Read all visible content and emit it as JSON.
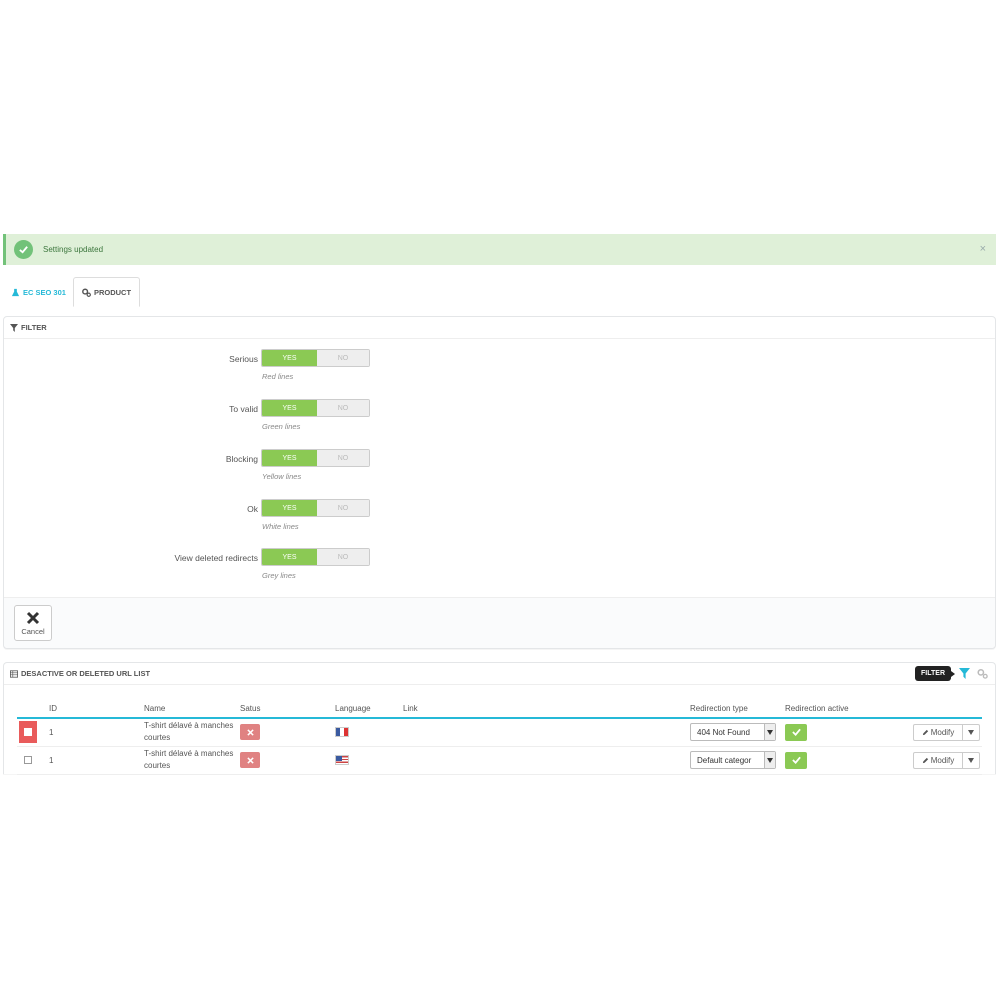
{
  "alert": {
    "message": "Settings updated",
    "close": "×"
  },
  "tabs": [
    {
      "label": "EC SEO 301",
      "icon": "flask-icon",
      "active": false
    },
    {
      "label": "PRODUCT",
      "icon": "gears-icon",
      "active": true
    }
  ],
  "filter_panel": {
    "title": "FILTER",
    "rows": [
      {
        "label": "Serious",
        "yes": "YES",
        "no": "NO",
        "value": "YES",
        "help": "Red lines"
      },
      {
        "label": "To valid",
        "yes": "YES",
        "no": "NO",
        "value": "YES",
        "help": "Green lines"
      },
      {
        "label": "Blocking",
        "yes": "YES",
        "no": "NO",
        "value": "YES",
        "help": "Yellow lines"
      },
      {
        "label": "Ok",
        "yes": "YES",
        "no": "NO",
        "value": "YES",
        "help": "White lines"
      },
      {
        "label": "View deleted redirects",
        "yes": "YES",
        "no": "NO",
        "value": "YES",
        "help": "Grey lines"
      }
    ],
    "cancel_label": "Cancel"
  },
  "list_panel": {
    "title": "DESACTIVE OR DELETED URL LIST",
    "filter_tooltip": "FILTER",
    "columns": [
      "",
      "ID",
      "Name",
      "Satus",
      "Language",
      "Link",
      "Redirection type",
      "Redirection active",
      ""
    ],
    "rows": [
      {
        "highlight": "red",
        "id": "1",
        "name": "T-shirt délavé à manches courtes",
        "status": "disabled",
        "language": "fr-flag",
        "link": "",
        "redirection_type": "404 Not Found",
        "redirection_active": true,
        "modify_label": "Modify"
      },
      {
        "highlight": "none",
        "id": "1",
        "name": "T-shirt délavé à manches courtes",
        "status": "disabled",
        "language": "us-flag",
        "link": "",
        "redirection_type": "Default categor",
        "redirection_active": true,
        "modify_label": "Modify"
      }
    ]
  },
  "colors": {
    "success_bg": "#dff0d8",
    "success_icon": "#72c279",
    "switch_on": "#8bc954",
    "accent": "#25b9d7",
    "danger_row": "#e95b5b",
    "status_off": "#e08282"
  }
}
